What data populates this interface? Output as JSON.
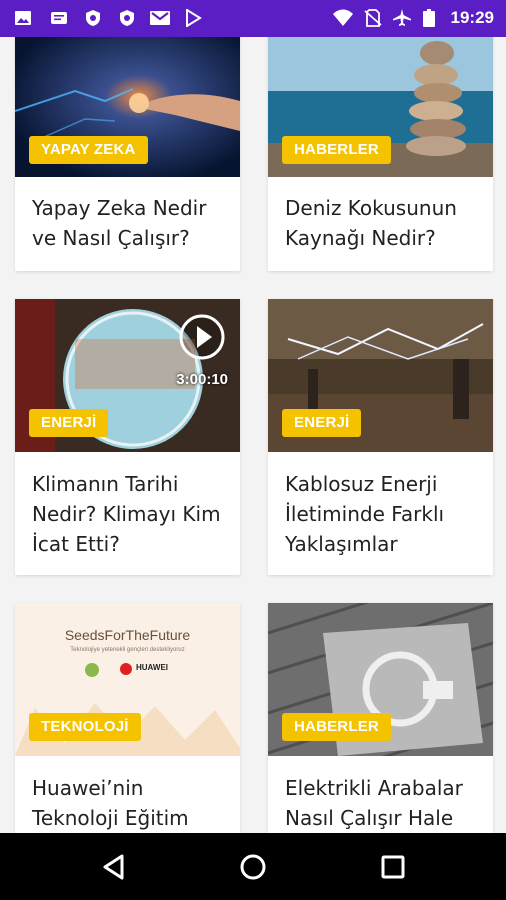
{
  "status_bar": {
    "time": "19:29",
    "left_icons": [
      "image-icon",
      "message-icon",
      "shield-icon",
      "shield-icon",
      "gmail-icon",
      "play-store-icon"
    ],
    "right_icons": [
      "wifi-icon",
      "no-sim-icon",
      "airplane-icon",
      "battery-icon"
    ]
  },
  "articles": [
    {
      "category": "YAPAY ZEKA",
      "title": "Yapay Zeka Nedir ve Nasıl Çalışır?"
    },
    {
      "category": "HABERLER",
      "title": "Deniz Kokusunun Kaynağı Nedir?"
    },
    {
      "category": "ENERJİ",
      "title": "Klimanın Tarihi Nedir? Klimayı Kim İcat Etti?",
      "video_duration": "3:00:10"
    },
    {
      "category": "ENERJİ",
      "title": "Kablosuz Enerji İletiminde Farklı Yaklaşımlar"
    },
    {
      "category": "TEKNOLOJİ",
      "title": "Huawei’nin Teknoloji Eğitim",
      "image_text": {
        "headline": "SeedsForTheFuture",
        "subline": "Teknolojiye yetenekli gençleri destekliyoruz",
        "brand": "HUAWEI"
      }
    },
    {
      "category": "HABERLER",
      "title": "Elektrikli Arabalar Nasıl Çalışır Hale"
    }
  ],
  "colors": {
    "status_bar": "#5b1ec5",
    "badge": "#f5c200",
    "page_bg": "#f3f3f3"
  },
  "nav_bar": {
    "buttons": [
      "back-icon",
      "home-icon",
      "recents-icon"
    ]
  }
}
